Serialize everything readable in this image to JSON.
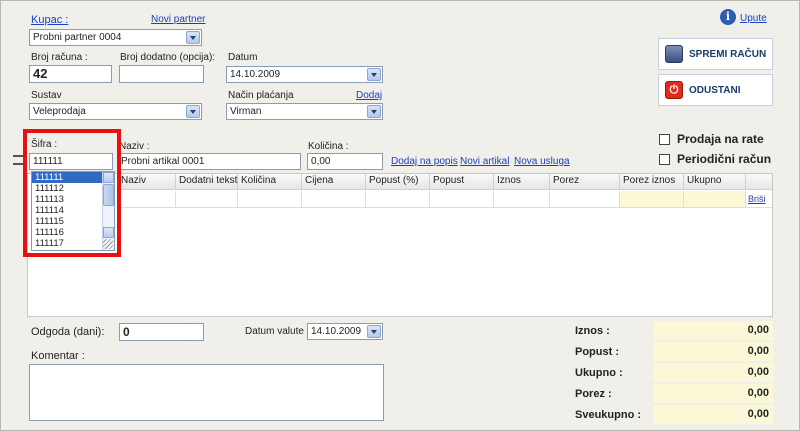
{
  "header": {
    "kupac_label": "Kupac :",
    "novi_partner": "Novi partner",
    "kupac_value": "Probni partner 0004",
    "help_label": "Upute"
  },
  "invoice": {
    "broj_racuna_label": "Broj računa :",
    "broj_racuna_value": "42",
    "broj_dodatno_label": "Broj dodatno (opcija):",
    "broj_dodatno_value": "",
    "datum_label": "Datum",
    "datum_value": "14.10.2009",
    "sustav_label": "Sustav",
    "sustav_value": "Veleprodaja",
    "nacin_placanja_label": "Način plaćanja",
    "nacin_placanja_value": "Virman",
    "dodaj_label": "Dodaj"
  },
  "actions": {
    "spremi_label": "SPREMI RAČUN",
    "odustani_label": "ODUSTANI"
  },
  "options": {
    "prodaja_na_rate": "Prodaja na rate",
    "periodicni_racun": "Periodični račun"
  },
  "item_entry": {
    "sifra_label": "Šifra :",
    "sifra_value": "111111",
    "naziv_label": "Naziv :",
    "naziv_value": "Probni artikal 0001",
    "kolicina_label": "Količina :",
    "kolicina_value": "0,00",
    "dodaj_na_popis": "Dodaj na popis",
    "novi_artikal": "Novi artikal",
    "nova_usluga": "Nova usluga"
  },
  "dropdown": {
    "options": [
      "111111",
      "111112",
      "111113",
      "111114",
      "111115",
      "111116",
      "111117"
    ],
    "selected_index": 0
  },
  "grid": {
    "columns": [
      "Naziv",
      "Dodatni tekst",
      "Količina",
      "Cijena",
      "Popust (%)",
      "Popust",
      "Iznos",
      "Porez",
      "Porez iznos",
      "Ukupno"
    ],
    "brisi": "Briši"
  },
  "footer": {
    "odgoda_label": "Odgoda (dani):",
    "odgoda_value": "0",
    "datum_valute_label": "Datum valute",
    "datum_valute_value": "14.10.2009",
    "komentar_label": "Komentar :",
    "komentar_value": ""
  },
  "summary": {
    "iznos_label": "Iznos :",
    "iznos_value": "0,00",
    "popust_label": "Popust :",
    "popust_value": "0,00",
    "ukupno_label": "Ukupno :",
    "ukupno_value": "0,00",
    "porez_label": "Porez :",
    "porez_value": "0,00",
    "sveukupno_label": "Sveukupno :",
    "sveukupno_value": "0,00"
  }
}
